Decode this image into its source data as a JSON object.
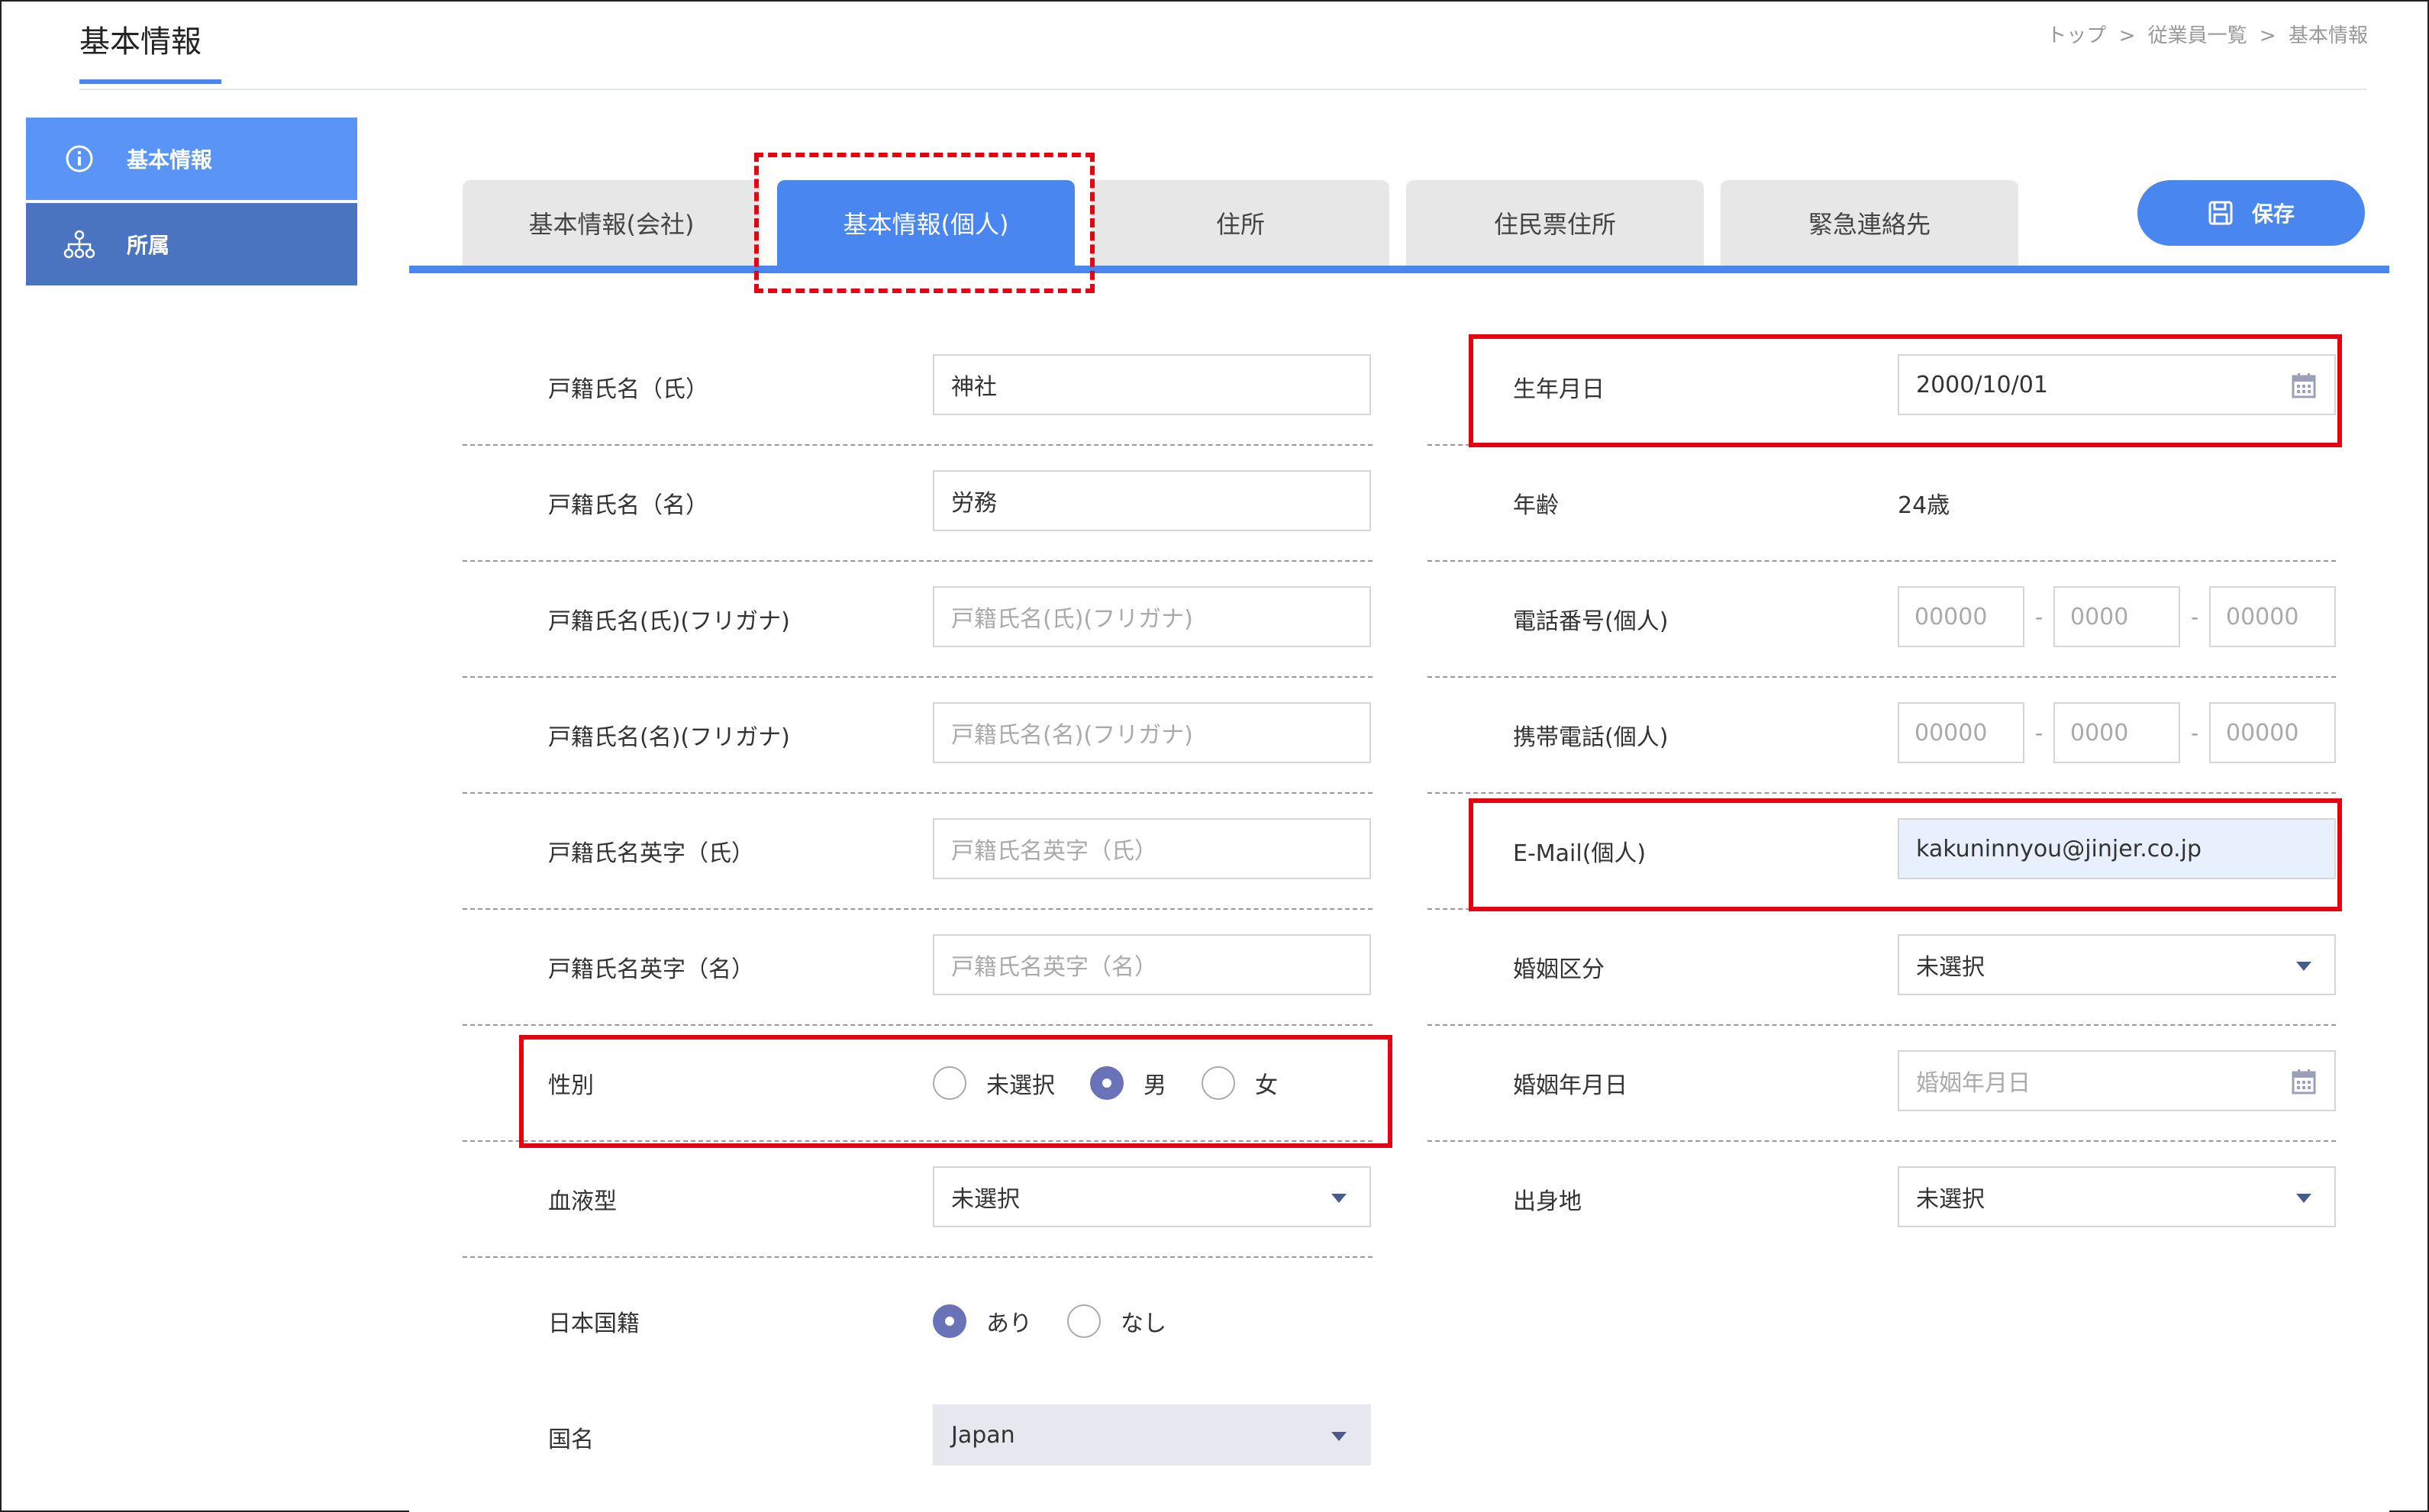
{
  "header": {
    "title": "基本情報",
    "breadcrumb": [
      "トップ",
      ">",
      "従業員一覧",
      ">",
      "基本情報"
    ]
  },
  "sidebar": {
    "items": [
      {
        "label": "基本情報",
        "icon": "info-icon",
        "active": true
      },
      {
        "label": "所属",
        "icon": "org-chart-icon",
        "active": false
      }
    ]
  },
  "tabs": [
    {
      "label": "基本情報(会社)",
      "active": false
    },
    {
      "label": "基本情報(個人)",
      "active": true
    },
    {
      "label": "住所",
      "active": false
    },
    {
      "label": "住民票住所",
      "active": false
    },
    {
      "label": "緊急連絡先",
      "active": false
    }
  ],
  "toolbar": {
    "save_label": "保存"
  },
  "left_form": {
    "family_name": {
      "label": "戸籍氏名（氏）",
      "value": "神社"
    },
    "given_name": {
      "label": "戸籍氏名（名）",
      "value": "労務"
    },
    "family_kana": {
      "label": "戸籍氏名(氏)(フリガナ)",
      "placeholder": "戸籍氏名(氏)(フリガナ)"
    },
    "given_kana": {
      "label": "戸籍氏名(名)(フリガナ)",
      "placeholder": "戸籍氏名(名)(フリガナ)"
    },
    "family_en": {
      "label": "戸籍氏名英字（氏）",
      "placeholder": "戸籍氏名英字（氏）"
    },
    "given_en": {
      "label": "戸籍氏名英字（名）",
      "placeholder": "戸籍氏名英字（名）"
    },
    "gender": {
      "label": "性別",
      "options": [
        "未選択",
        "男",
        "女"
      ],
      "selected": "男"
    },
    "blood_type": {
      "label": "血液型",
      "value": "未選択"
    },
    "japanese_nationality": {
      "label": "日本国籍",
      "options": [
        "あり",
        "なし"
      ],
      "selected": "あり"
    },
    "country": {
      "label": "国名",
      "value": "Japan"
    }
  },
  "right_form": {
    "birthdate": {
      "label": "生年月日",
      "value": "2000/10/01"
    },
    "age": {
      "label": "年齢",
      "value": "24歳"
    },
    "phone": {
      "label": "電話番号(個人)",
      "placeholders": [
        "00000",
        "0000",
        "00000"
      ],
      "separator": "-"
    },
    "mobile": {
      "label": "携帯電話(個人)",
      "placeholders": [
        "00000",
        "0000",
        "00000"
      ],
      "separator": "-"
    },
    "email": {
      "label": "E-Mail(個人)",
      "value": "kakuninnyou@jinjer.co.jp"
    },
    "marital_status": {
      "label": "婚姻区分",
      "value": "未選択"
    },
    "marriage_date": {
      "label": "婚姻年月日",
      "placeholder": "婚姻年月日"
    },
    "birthplace": {
      "label": "出身地",
      "value": "未選択"
    }
  },
  "colors": {
    "accent": "#4a86f0",
    "annotation": "#e60012",
    "sidebar_active": "#5a94f6",
    "sidebar": "#4a74c0"
  }
}
